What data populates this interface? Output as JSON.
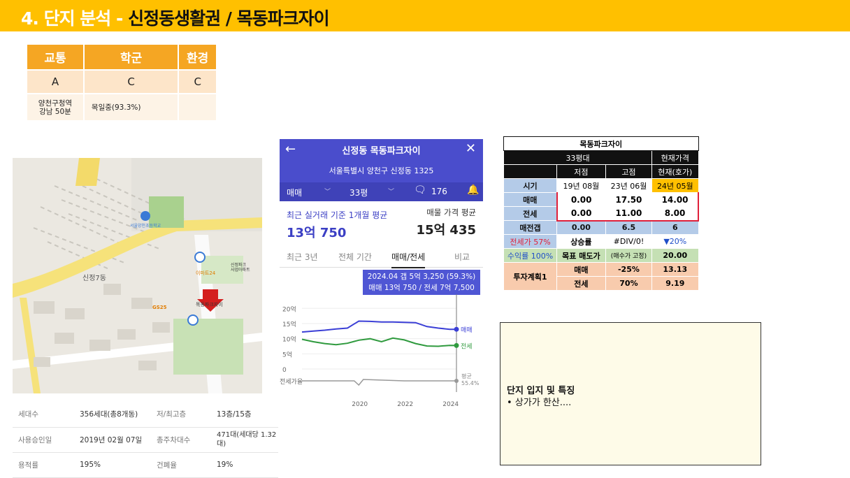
{
  "title": {
    "main": "4. 단지 분석 - ",
    "highlight": "신정동생활권 /  목동파크자이"
  },
  "summary": {
    "headers": [
      "교통",
      "학군",
      "환경"
    ],
    "grades": [
      "A",
      "C",
      "C"
    ],
    "details": [
      "양천구청역\n강남 50분",
      "목일중(93.3%)",
      ""
    ]
  },
  "map_labels": {
    "area": "신정7동",
    "poi_1": "목동파크자이",
    "poi_2": "서울양천초등학교",
    "poi_3": "GS25",
    "poi_4": "이마트24",
    "poi_5": "신정파크\n사업아파트"
  },
  "info": [
    {
      "k1": "세대수",
      "v1": "356세대(총8개동)",
      "k2": "저/최고층",
      "v2": "13층/15층"
    },
    {
      "k1": "사용승인일",
      "v1": "2019년 02월 07일",
      "k2": "총주차대수",
      "v2": "471대(세대당 1.32대)"
    },
    {
      "k1": "용적률",
      "v1": "195%",
      "k2": "건폐율",
      "v2": "19%"
    }
  ],
  "app": {
    "back_icon": "arrow-left-icon",
    "close_icon": "close-icon",
    "name": "신정동 목동파크자이",
    "address": "서울특별시 양천구 신정동 1325",
    "trade_type": "매매",
    "size": "33평",
    "comments": "176",
    "sub_left": "최근 실거래 기준 1개월 평균",
    "sub_right": "매물 가격 평균",
    "price_left": "13억 750",
    "price_right": "15억 435",
    "tabs": [
      "최근 3년",
      "전체 기간",
      "매매/전세",
      "비교"
    ],
    "tip_line1": "2024.04  갭 5억 3,250 (59.3%)",
    "tip_line2": "매매 13억 750 / 전세 7억 7,500"
  },
  "chart_data": {
    "type": "line",
    "x": [
      2017.5,
      2018,
      2018.5,
      2019,
      2019.5,
      2020,
      2020.5,
      2021,
      2021.5,
      2022,
      2022.5,
      2023,
      2023.5,
      2024,
      2024.3
    ],
    "xlabel": "",
    "ylabel": "",
    "y_ticks": [
      "20억",
      "15억",
      "10억",
      "5억",
      "0"
    ],
    "x_ticks": [
      "2020",
      "2022",
      "2024"
    ],
    "ylim": [
      0,
      20
    ],
    "series": [
      {
        "name": "매매",
        "color": "#3b3fd6",
        "values": [
          12.2,
          12.5,
          12.8,
          13.2,
          13.5,
          15.8,
          15.7,
          15.5,
          15.5,
          15.4,
          15.3,
          14.0,
          13.5,
          13.1,
          13.1
        ]
      },
      {
        "name": "전세",
        "color": "#2f9a3e",
        "values": [
          9.8,
          9.0,
          8.4,
          8.0,
          8.5,
          9.5,
          10.0,
          9.0,
          10.2,
          9.6,
          8.4,
          7.6,
          7.5,
          7.8,
          7.75
        ]
      }
    ],
    "bottom_label": "전세가율",
    "bottom_right": "평균\n55.4%"
  },
  "price_table": {
    "title": "목동파크자이",
    "size": "33평대",
    "current": "현재가격",
    "col_low": "저점",
    "col_high": "고점",
    "col_now": "현재(호가)",
    "row_time": "시기",
    "t_low": "19년 08월",
    "t_high": "23년 06월",
    "t_now": "24년 05월",
    "row_sale": "매매",
    "sale_low": "0.00",
    "sale_high": "17.50",
    "sale_now": "14.00",
    "row_rent": "전세",
    "rent_low": "0.00",
    "rent_high": "11.00",
    "rent_now": "8.00",
    "gap_label": "매전갭",
    "gap_low": "0.00",
    "gap_high": "6.5",
    "gap_now": "6",
    "ratio_label": "전세가 57%",
    "rise_label": "상승률",
    "rise_val": "#DIV/0!",
    "rise_now": "▼20%",
    "yield_label": "수익률 100%",
    "target_label": "목표 매도가",
    "target_note": "(매수가 고정)",
    "target_val": "20.00",
    "plan_label": "투자계획1",
    "plan_sale": "매매",
    "plan_sale_pct": "-25%",
    "plan_sale_val": "13.13",
    "plan_rent": "전세",
    "plan_rent_pct": "70%",
    "plan_rent_val": "9.19"
  },
  "note": {
    "heading": "단지 입지 및 특징",
    "bullet": "•  상가가 한산...."
  }
}
